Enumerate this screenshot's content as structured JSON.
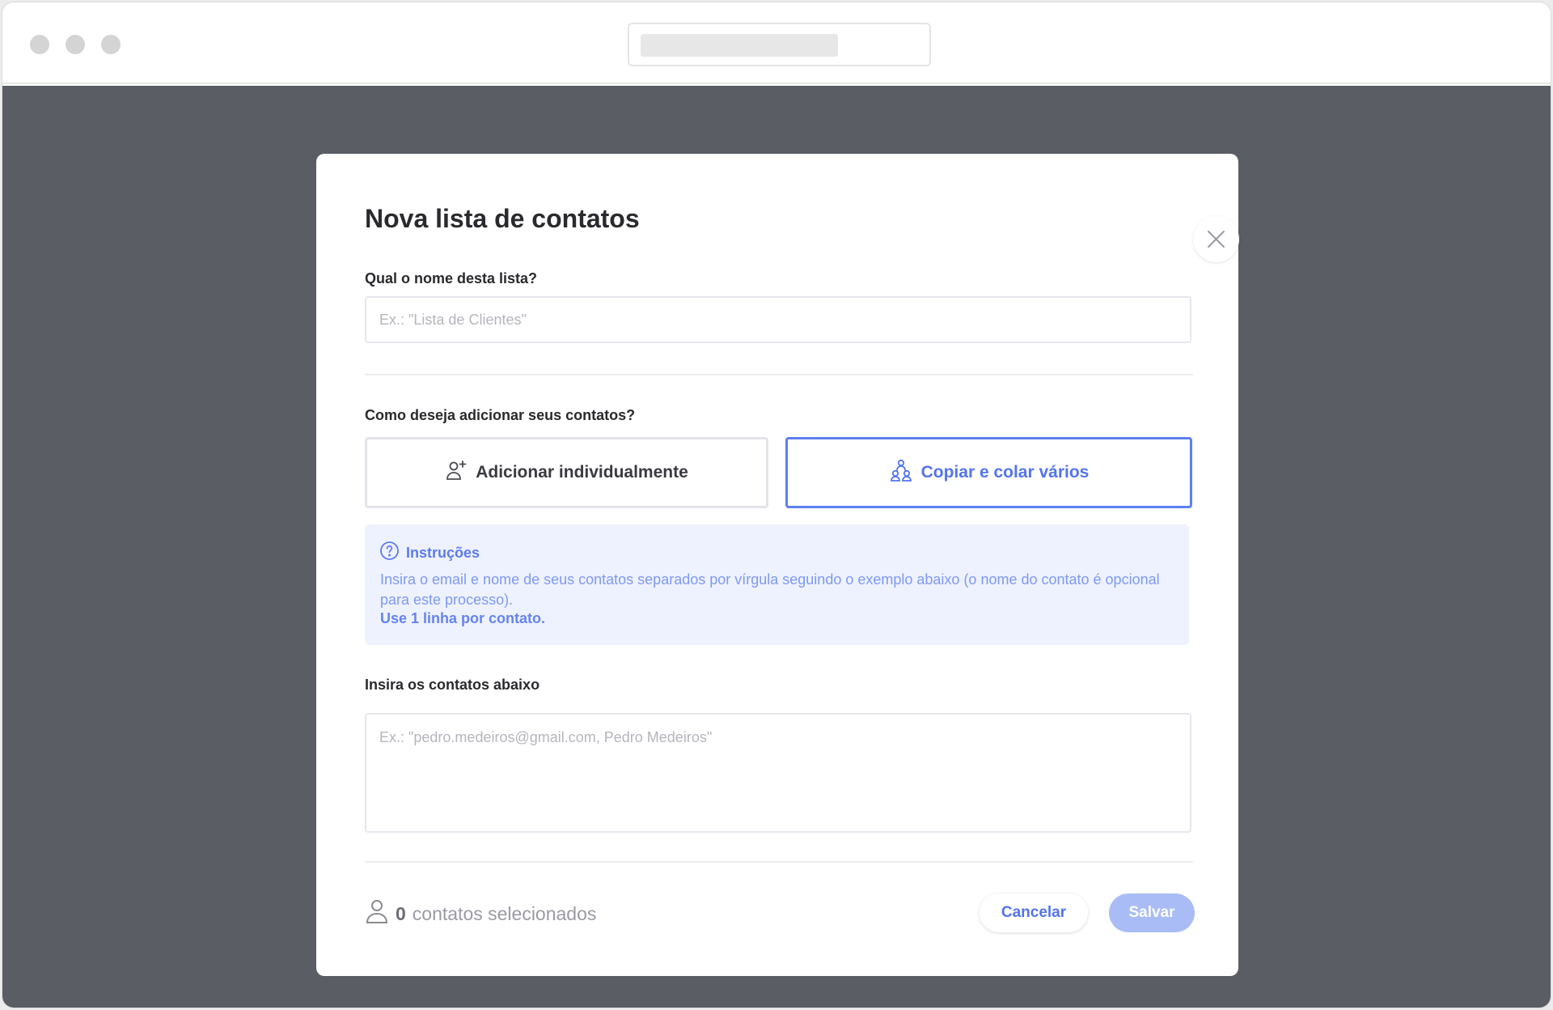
{
  "browser": {
    "window_controls": [
      "close",
      "minimize",
      "maximize"
    ]
  },
  "modal": {
    "title": "Nova lista de contatos",
    "name_field": {
      "label": "Qual o nome desta lista?",
      "placeholder": "Ex.: \"Lista de Clientes\"",
      "value": ""
    },
    "add_method": {
      "label": "Como deseja adicionar seus contatos?",
      "options": [
        {
          "label": "Adicionar individualmente",
          "icon": "user-plus-icon",
          "selected": false
        },
        {
          "label": "Copiar e colar vários",
          "icon": "users-group-icon",
          "selected": true
        }
      ]
    },
    "instructions": {
      "title": "Instruções",
      "icon": "help-circle-icon",
      "text": "Insira o email e nome de seus contatos separados por vírgula seguindo o exemplo abaixo (o nome do contato é opcional para este processo).",
      "emphasis": "Use 1 linha por contato."
    },
    "contacts_field": {
      "label": "Insira os contatos abaixo",
      "placeholder": "Ex.: \"pedro.medeiros@gmail.com, Pedro Medeiros\"",
      "value": ""
    },
    "footer": {
      "count": "0",
      "count_label": "contatos selecionados",
      "cancel_label": "Cancelar",
      "save_label": "Salvar"
    }
  },
  "colors": {
    "accent": "#5474ee",
    "overlay": "#5a5d64",
    "instructions_bg": "#eef2fe",
    "save_disabled": "#a9bcf6"
  }
}
